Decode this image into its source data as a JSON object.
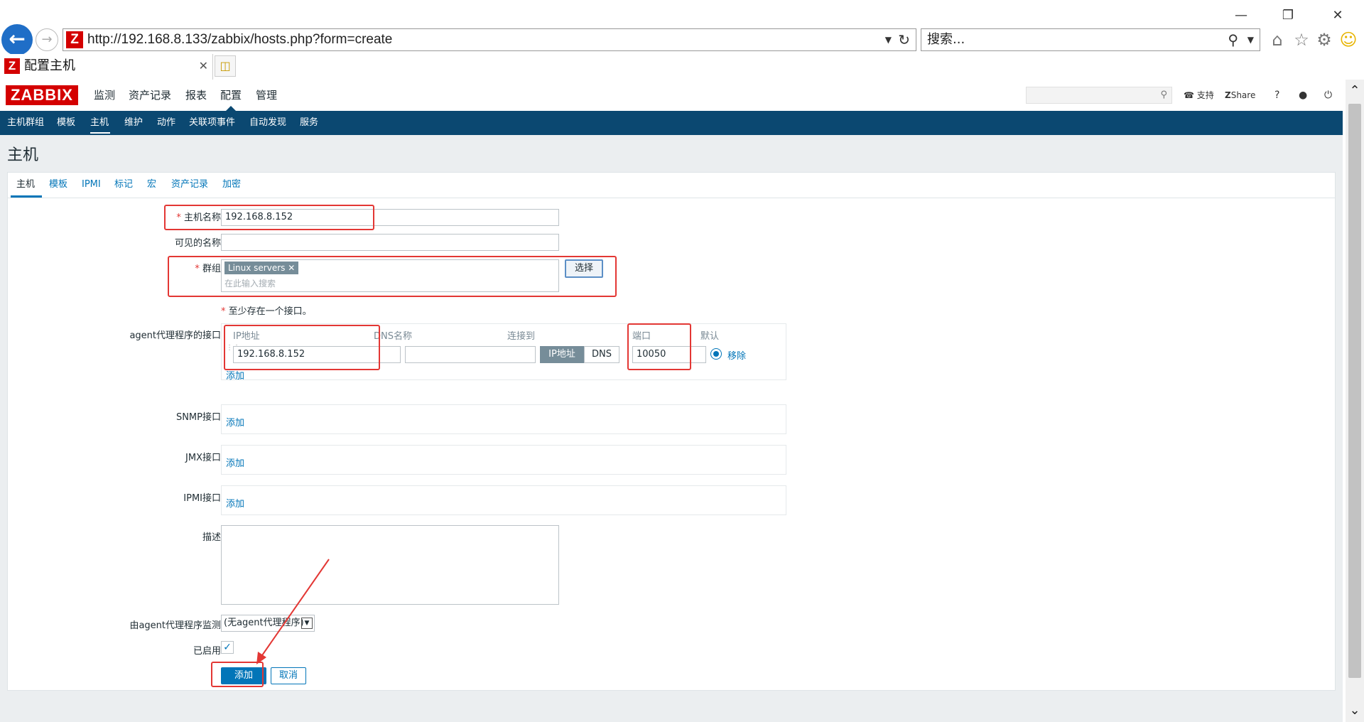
{
  "window": {
    "minimize": "—",
    "restore": "❐",
    "close": "✕"
  },
  "browser": {
    "url": "http://192.168.8.133/zabbix/hosts.php?form=create",
    "search_placeholder": "搜索...",
    "tab_title": "配置主机",
    "favicon_letter": "Z"
  },
  "zabbix": {
    "logo": "ZABBIX",
    "top_menu": [
      "监测",
      "资产记录",
      "报表",
      "配置",
      "管理"
    ],
    "active_top": "配置",
    "header_links": {
      "support": "支持",
      "share": "Share",
      "help": "?"
    },
    "sub_menu": [
      "主机群组",
      "模板",
      "主机",
      "维护",
      "动作",
      "关联项事件",
      "自动发现",
      "服务"
    ],
    "active_sub": "主机"
  },
  "page": {
    "title": "主机"
  },
  "form_tabs": [
    "主机",
    "模板",
    "IPMI",
    "标记",
    "宏",
    "资产记录",
    "加密"
  ],
  "form": {
    "host_name_label": "主机名称",
    "host_name_value": "192.168.8.152",
    "visible_name_label": "可见的名称",
    "visible_name_value": "",
    "groups_label": "群组",
    "group_tag": "Linux servers",
    "group_search_placeholder": "在此输入搜索",
    "select_button": "选择",
    "interface_note": "至少存在一个接口。",
    "agent_interfaces_label": "agent代理程序的接口",
    "col_ip": "IP地址",
    "col_dns": "DNS名称",
    "col_connect": "连接到",
    "col_port": "端口",
    "col_default": "默认",
    "ip_value": "192.168.8.152",
    "dns_value": "",
    "connect_ip": "IP地址",
    "connect_dns": "DNS",
    "port_value": "10050",
    "remove_link": "移除",
    "add_link": "添加",
    "snmp_label": "SNMP接口",
    "jmx_label": "JMX接口",
    "ipmi_label": "IPMI接口",
    "description_label": "描述",
    "description_value": "",
    "monitored_by_label": "由agent代理程序监测",
    "proxy_value": "(无agent代理程序)",
    "enabled_label": "已启用",
    "enabled": true,
    "add_button": "添加",
    "cancel_button": "取消"
  },
  "colors": {
    "zabbix_red": "#d40000",
    "nav_blue": "#0b4871",
    "link_blue": "#0275b8",
    "annotation_red": "#e33734"
  }
}
